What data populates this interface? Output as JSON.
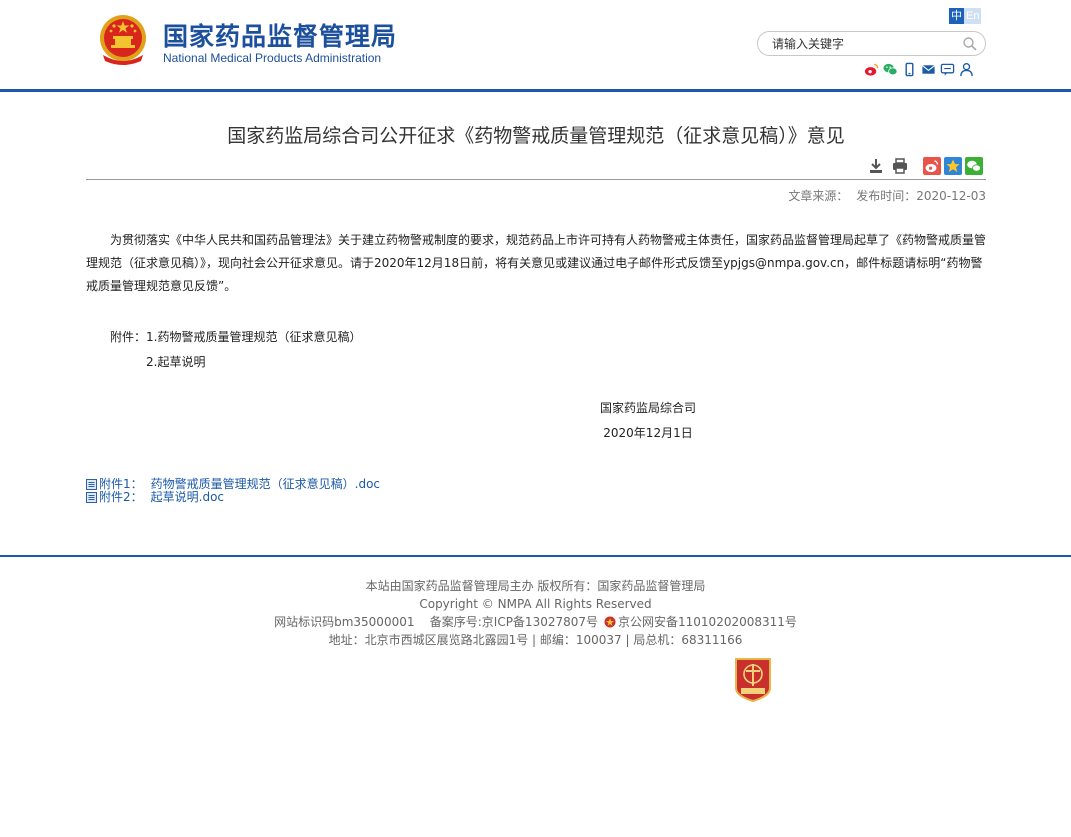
{
  "header": {
    "logo_cn": "国家药品监督管理局",
    "logo_en": "National Medical Products Administration",
    "lang_cn": "中",
    "lang_en": "En",
    "search_placeholder": "请输入关键字",
    "social_icons": [
      "weibo-icon",
      "wechat-icon",
      "mobile-icon",
      "email-icon",
      "message-icon",
      "user-icon"
    ]
  },
  "article": {
    "title": "国家药监局综合司公开征求《药物警戒质量管理规范（征求意见稿）》意见",
    "source_label": "文章来源：",
    "publish_label": "发布时间：2020-12-03",
    "paragraph": "为贯彻落实《中华人民共和国药品管理法》关于建立药物警戒制度的要求，规范药品上市许可持有人药物警戒主体责任，国家药品监督管理局起草了《药物警戒质量管理规范（征求意见稿）》，现向社会公开征求意见。请于2020年12月18日前，将有关意见或建议通过电子邮件形式反馈至ypjgs@nmpa.gov.cn，邮件标题请标明“药物警戒质量管理规范意见反馈”。",
    "attach_line1": "附件：1.药物警戒质量管理规范（征求意见稿）",
    "attach_line2": "2.起草说明",
    "sign_org": "国家药监局综合司",
    "sign_date": "2020年12月1日",
    "files": [
      {
        "label": "附件1：",
        "name": "药物警戒质量管理规范（征求意见稿）.doc"
      },
      {
        "label": "附件2：",
        "name": "起草说明.doc"
      }
    ]
  },
  "footer": {
    "line1": "本站由国家药品监督管理局主办 版权所有：国家药品监督管理局",
    "line2": "Copyright © NMPA All Rights Reserved",
    "line3a": "网站标识码bm35000001    备案序号:京ICP备13027807号",
    "line3b": "京公网安备11010202008311号",
    "line4": "地址：北京市西城区展览路北露园1号 | 邮编：100037 | 局总机：68311166"
  },
  "colors": {
    "brand_blue": "#1c4f9c",
    "line_blue": "#1c5aa8",
    "link_blue": "#1c5aa8"
  }
}
